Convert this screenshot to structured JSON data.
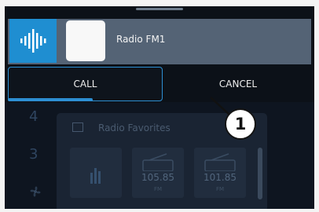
{
  "now_playing": {
    "station": "Radio FM1",
    "icon": "audio-waveform-icon"
  },
  "actions": {
    "call_label": "CALL",
    "cancel_label": "CANCEL",
    "call_timeout_progress": 0.55
  },
  "background": {
    "side_numbers": [
      "4",
      "3"
    ],
    "side_icon": "fan-icon",
    "favorites_title": "Radio Favorites",
    "favorites_icon": "dropdown-icon",
    "tiles": [
      {
        "icon": "bar-chart-icon",
        "frequency": "",
        "band": ""
      },
      {
        "icon": "radio-icon",
        "frequency": "105.85",
        "band": "FM"
      },
      {
        "icon": "radio-icon",
        "frequency": "101.85",
        "band": "FM"
      }
    ]
  },
  "callout": {
    "number": "1"
  },
  "colors": {
    "accent": "#2d8fd3",
    "header": "#546375",
    "background": "#0c1118"
  }
}
